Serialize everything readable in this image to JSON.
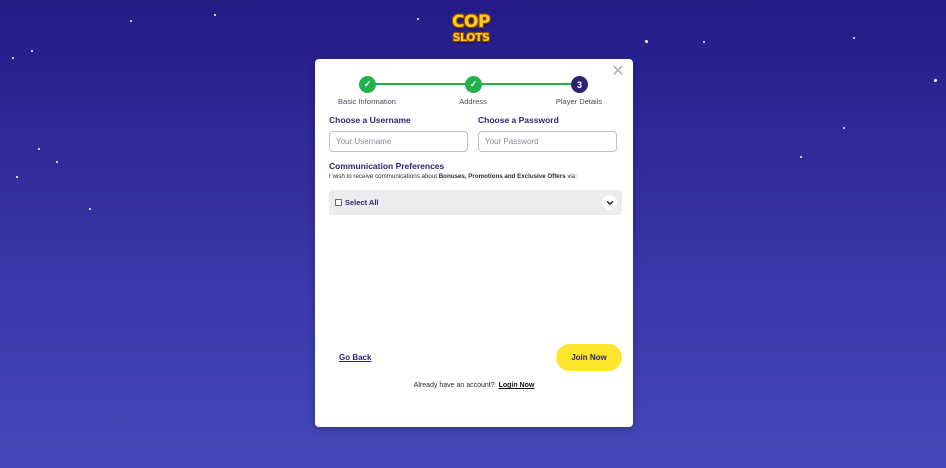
{
  "brand": {
    "logo_line1": "COP",
    "logo_line2": "SLOTS"
  },
  "stepper": {
    "steps": [
      {
        "label": "Basic Information",
        "status": "done",
        "icon": "check-icon",
        "symbol": "✓"
      },
      {
        "label": "Address",
        "status": "done",
        "icon": "check-icon",
        "symbol": "✓"
      },
      {
        "label": "Player Details",
        "status": "current",
        "number": "3"
      }
    ]
  },
  "form": {
    "username": {
      "label": "Choose a Username",
      "placeholder": "Your Username",
      "value": ""
    },
    "password": {
      "label": "Choose a Password",
      "placeholder": "Your Password",
      "value": ""
    }
  },
  "preferences": {
    "title": "Communication Preferences",
    "desc_prefix": "I wish to receive communications about ",
    "desc_bold": "Bonuses, Promotions and Exclusive Offers",
    "desc_suffix": " via:",
    "select_all_label": "Select All",
    "select_all_checked": false
  },
  "actions": {
    "go_back_label": "Go Back",
    "join_label": "Join Now",
    "login_prompt": "Already have an account?",
    "login_label": "Login Now"
  },
  "icons": {
    "close": "close-icon",
    "chevron": "chevron-down-icon"
  },
  "colors": {
    "step_done": "#22b14c",
    "step_current": "#2b2470",
    "join_button": "#ffe52b",
    "label_text": "#2b2470",
    "select_bar": "#ececee"
  }
}
